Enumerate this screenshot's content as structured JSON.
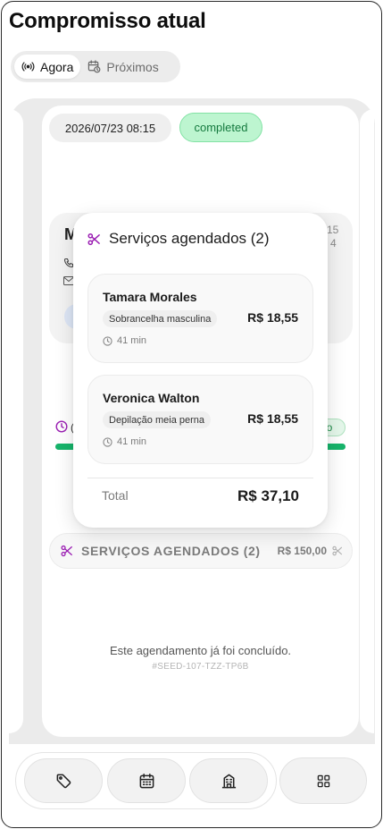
{
  "page": {
    "title": "Compromisso atual"
  },
  "tabs": [
    {
      "label": "Agora",
      "icon": "broadcast-icon",
      "active": true
    },
    {
      "label": "Próximos",
      "icon": "calendar-clock-icon",
      "active": false
    }
  ],
  "appointment": {
    "datetime": "2026/07/23 08:15",
    "status": "completed",
    "client_initial": "M",
    "side_text_top": "15",
    "side_text_bottom": "4",
    "progress_status_partial": "do",
    "progress": 1.0,
    "concluded_message": "Este agendamento já foi concluído.",
    "reference_code": "#SEED-107-TZZ-TP6B"
  },
  "services_bar": {
    "title": "SERVIÇOS AGENDADOS (2)",
    "amount": "R$ 150,00"
  },
  "popover": {
    "title": "Serviços agendados (2)",
    "items": [
      {
        "professional": "Tamara Morales",
        "service": "Sobrancelha masculina",
        "price": "R$ 18,55",
        "duration": "41 min"
      },
      {
        "professional": "Veronica Walton",
        "service": "Depilação meia perna",
        "price": "R$ 18,55",
        "duration": "41 min"
      }
    ],
    "total_label": "Total",
    "total_value": "R$ 37,10"
  },
  "bottom_nav": {
    "buttons": [
      "tag-icon",
      "calendar-icon",
      "building-icon",
      "grid-icon"
    ]
  },
  "colors": {
    "accent_purple": "#9b1fb3",
    "success_green": "#17b46b",
    "status_bg": "#bdf5d0"
  }
}
